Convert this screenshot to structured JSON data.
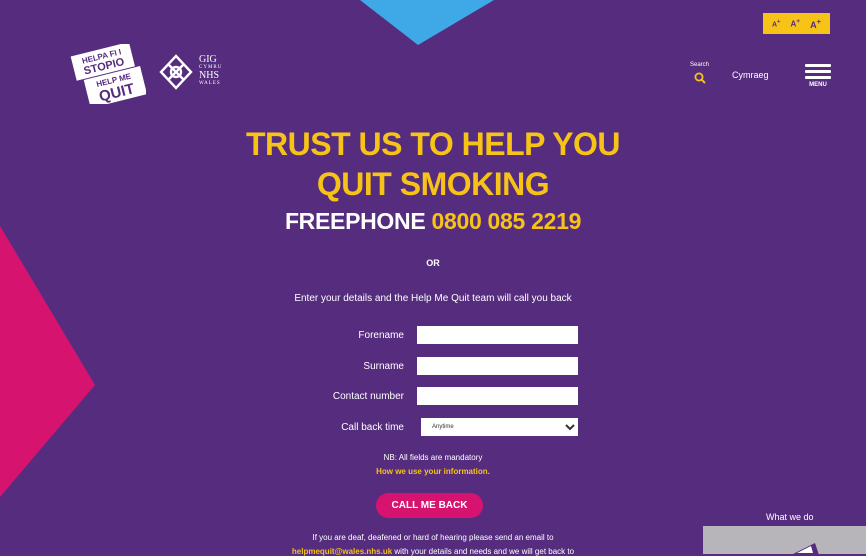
{
  "colors": {
    "background": "#552c7e",
    "accent_yellow": "#f6c316",
    "accent_pink": "#d6146f",
    "accent_blue": "#3fa8e6",
    "white": "#ffffff"
  },
  "header": {
    "font_size_controls": [
      "A",
      "A",
      "A"
    ],
    "font_size_marks": [
      "+",
      "+",
      "+"
    ],
    "logo": {
      "lines": [
        "HELPA FI I",
        "STOPIO",
        "HELP ME",
        "QUIT"
      ],
      "nhs_lines": [
        "GIG",
        "CYMRU",
        "NHS",
        "WALES"
      ]
    },
    "search": {
      "label": "Search",
      "icon": "search-icon"
    },
    "language_link": "Cymraeg",
    "menu": {
      "label": "MENU",
      "icon": "hamburger-icon"
    }
  },
  "hero": {
    "line1": "TRUST US TO HELP YOU",
    "line2": "QUIT SMOKING",
    "freephone_label": "FREEPHONE",
    "freephone_number": "0800 085 2219"
  },
  "form": {
    "or_text": "OR",
    "intro": "Enter your details and the Help Me Quit team will call you back",
    "fields": {
      "forename": {
        "label": "Forename",
        "value": ""
      },
      "surname": {
        "label": "Surname",
        "value": ""
      },
      "contact": {
        "label": "Contact number",
        "value": ""
      },
      "callback": {
        "label": "Call back time",
        "selected": "Anytime"
      }
    },
    "nb": "NB: All fields are mandatory",
    "info_link": "How we use your information.",
    "submit": "CALL ME BACK"
  },
  "footer": {
    "deaf_text": "If you are deaf, deafened or hard of hearing please send an email to",
    "email": "helpmequit@wales.nhs.uk",
    "email_suffix": "with your details and needs and we will get back to"
  },
  "side_panel": {
    "title": "What we do"
  }
}
